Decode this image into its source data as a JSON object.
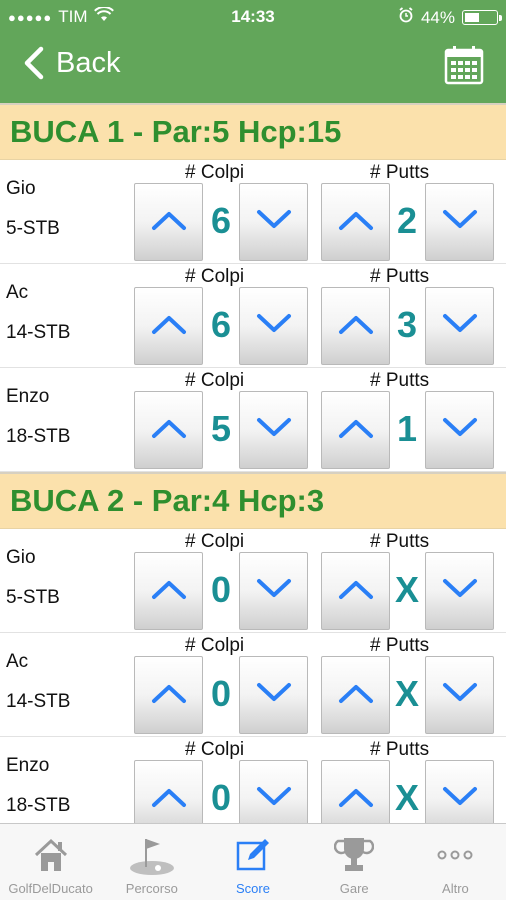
{
  "status_bar": {
    "carrier": "TIM",
    "time": "14:33",
    "battery": "44%",
    "battery_level": 0.44
  },
  "nav": {
    "back_label": "Back"
  },
  "holes": [
    {
      "title": "BUCA 1 - Par:5 Hcp:15",
      "players": [
        {
          "name": "Gio",
          "hcp": "5-STB",
          "colpi_label": "# Colpi",
          "colpi": "6",
          "putts_label": "# Putts",
          "putts": "2"
        },
        {
          "name": "Ac",
          "hcp": "14-STB",
          "colpi_label": "# Colpi",
          "colpi": "6",
          "putts_label": "# Putts",
          "putts": "3"
        },
        {
          "name": "Enzo",
          "hcp": "18-STB",
          "colpi_label": "# Colpi",
          "colpi": "5",
          "putts_label": "# Putts",
          "putts": "1"
        }
      ]
    },
    {
      "title": "BUCA 2 - Par:4 Hcp:3",
      "players": [
        {
          "name": "Gio",
          "hcp": "5-STB",
          "colpi_label": "# Colpi",
          "colpi": "0",
          "putts_label": "# Putts",
          "putts": "X"
        },
        {
          "name": "Ac",
          "hcp": "14-STB",
          "colpi_label": "# Colpi",
          "colpi": "0",
          "putts_label": "# Putts",
          "putts": "X"
        },
        {
          "name": "Enzo",
          "hcp": "18-STB",
          "colpi_label": "# Colpi",
          "colpi": "0",
          "putts_label": "# Putts",
          "putts": "X"
        }
      ]
    }
  ],
  "tabs": [
    {
      "label": "GolfDelDucato",
      "icon": "home-icon",
      "active": false
    },
    {
      "label": "Percorso",
      "icon": "golf-flag-icon",
      "active": false
    },
    {
      "label": "Score",
      "icon": "edit-icon",
      "active": true
    },
    {
      "label": "Gare",
      "icon": "trophy-icon",
      "active": false
    },
    {
      "label": "Altro",
      "icon": "more-icon",
      "active": false
    }
  ],
  "colors": {
    "header": "#62a65a",
    "hole_header_bg": "#fbe1ac",
    "hole_title": "#2f8f2f",
    "score_value": "#1a8f94",
    "arrow": "#2a7ff6",
    "tab_active": "#2a7ff6"
  }
}
